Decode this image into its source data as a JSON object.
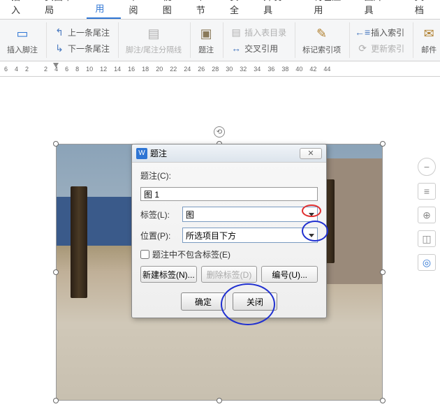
{
  "tabs": [
    "插入",
    "页面布局",
    "引用",
    "审阅",
    "视图",
    "章节",
    "安全",
    "开发工具",
    "特色应用",
    "图片工具",
    "文档"
  ],
  "active_tab": "引用",
  "ribbon": {
    "insert_footnote": "插入脚注",
    "prev_endnote": "上一条尾注",
    "next_endnote": "下一条尾注",
    "footnote_sep": "脚注/尾注分隔线",
    "caption": "题注",
    "insert_fig_table": "插入表目录",
    "cross_ref": "交叉引用",
    "mark_idx": "标记索引项",
    "insert_idx": "插入索引",
    "update_idx": "更新索引",
    "mail": "邮件"
  },
  "ruler_marks": [
    6,
    4,
    2,
    2,
    4,
    6,
    8,
    10,
    12,
    14,
    16,
    18,
    20,
    22,
    24,
    26,
    28,
    30,
    32,
    34,
    36,
    38,
    40,
    42,
    44
  ],
  "dialog": {
    "title": "题注",
    "caption_label": "题注(C):",
    "caption_value": "图 1",
    "label_label": "标签(L):",
    "label_value": "图",
    "position_label": "位置(P):",
    "position_value": "所选项目下方",
    "exclude_label": "题注中不包含标签(E)",
    "new_label": "新建标签(N)...",
    "del_label": "删除标签(D)",
    "number": "编号(U)...",
    "ok": "确定",
    "close": "关闭"
  }
}
